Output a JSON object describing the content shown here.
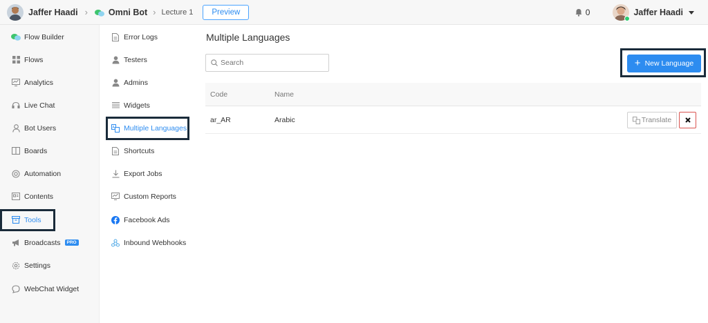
{
  "topbar": {
    "account_name": "Jaffer Haadi",
    "bot_name": "Omni Bot",
    "lecture": "Lecture 1",
    "preview_label": "Preview",
    "notifications_count": "0",
    "user_name": "Jaffer Haadi"
  },
  "sidebar": {
    "items": [
      {
        "label": "Flow Builder",
        "icon": "bot-chat-icon"
      },
      {
        "label": "Flows",
        "icon": "grid-icon"
      },
      {
        "label": "Analytics",
        "icon": "analytics-icon"
      },
      {
        "label": "Live Chat",
        "icon": "headset-icon"
      },
      {
        "label": "Bot Users",
        "icon": "user-icon"
      },
      {
        "label": "Boards",
        "icon": "board-icon"
      },
      {
        "label": "Automation",
        "icon": "automation-icon"
      },
      {
        "label": "Contents",
        "icon": "contents-icon"
      },
      {
        "label": "Tools",
        "icon": "toolbox-icon",
        "active": true
      },
      {
        "label": "Broadcasts",
        "icon": "megaphone-icon",
        "badge": "PRO"
      },
      {
        "label": "Settings",
        "icon": "gear-icon"
      },
      {
        "label": "WebChat Widget",
        "icon": "chat-bubble-icon"
      }
    ]
  },
  "submenu": {
    "items": [
      {
        "label": "Error Logs",
        "icon": "document-icon"
      },
      {
        "label": "Testers",
        "icon": "person-icon"
      },
      {
        "label": "Admins",
        "icon": "person-icon"
      },
      {
        "label": "Widgets",
        "icon": "widgets-icon"
      },
      {
        "label": "Multiple Languages",
        "icon": "translate-icon",
        "active": true
      },
      {
        "label": "Shortcuts",
        "icon": "document-icon"
      },
      {
        "label": "Export Jobs",
        "icon": "download-icon"
      },
      {
        "label": "Custom Reports",
        "icon": "report-icon"
      },
      {
        "label": "Facebook Ads",
        "icon": "facebook-icon"
      },
      {
        "label": "Inbound Webhooks",
        "icon": "webhook-icon"
      }
    ]
  },
  "main": {
    "title": "Multiple Languages",
    "search_placeholder": "Search",
    "new_button_label": "New Language",
    "table": {
      "columns": [
        "Code",
        "Name"
      ],
      "rows": [
        {
          "code": "ar_AR",
          "name": "Arabic",
          "translate_label": "Translate"
        }
      ]
    }
  },
  "colors": {
    "accent": "#2d8cf0",
    "highlight_box": "#1a2b3a",
    "delete": "#d9534f",
    "online": "#2ecc71"
  }
}
